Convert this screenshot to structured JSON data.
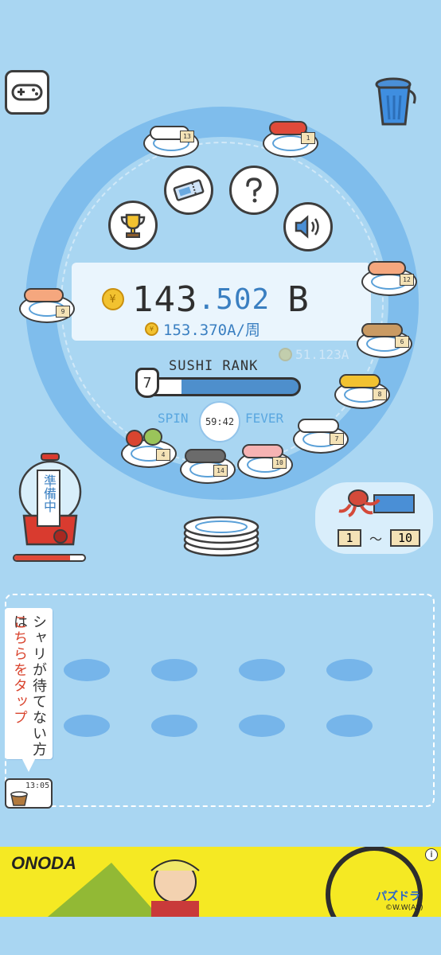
{
  "score": {
    "main": "143",
    "decimal": ".502",
    "unit": "B",
    "rate": "153.370A/周",
    "ghost": "51.123A"
  },
  "rank": {
    "label": "SUSHI RANK",
    "level": "7",
    "progress": 0.27
  },
  "spin": {
    "spin_label": "SPIN",
    "fever_label": "FEVER",
    "timer": "59:42"
  },
  "gacha": {
    "status": "準備中",
    "progress": 0.8
  },
  "octopus_panel": {
    "range_from": "1",
    "range_sep": "〜",
    "range_to": "10"
  },
  "side_note": {
    "line1": "シャリが待てない方は",
    "line2": "こちらをタップ"
  },
  "rice_timer": "13:05",
  "plates": [
    {
      "id": "p13",
      "num": "13",
      "color": "#ffffff"
    },
    {
      "id": "p1",
      "num": "1",
      "color": "#e04a3a"
    },
    {
      "id": "p12",
      "num": "12",
      "color": "#f5a77e"
    },
    {
      "id": "p6",
      "num": "6",
      "color": "#c99a63"
    },
    {
      "id": "p8",
      "num": "8",
      "color": "#f2c230"
    },
    {
      "id": "p7",
      "num": "7",
      "color": "#ffffff"
    },
    {
      "id": "p10",
      "num": "10",
      "color": "#f6b3b3"
    },
    {
      "id": "p14",
      "num": "14",
      "color": "#6b6b6b"
    },
    {
      "id": "p4",
      "num": "4",
      "color": "#d9452f"
    },
    {
      "id": "p9",
      "num": "9",
      "color": "#f5a77e"
    }
  ],
  "ad": {
    "left_text": "ONODA",
    "right_text": "パズドラ",
    "copyright": "©W.W(AS)"
  },
  "colors": {
    "bg": "#a9d6f2",
    "ring": "#7fbdec",
    "accent": "#3a7fc1",
    "coin": "#f2c230"
  },
  "icons": [
    "gamepad-icon",
    "trash-can-icon",
    "trophy-icon",
    "ticket-icon",
    "question-icon",
    "speaker-icon"
  ]
}
